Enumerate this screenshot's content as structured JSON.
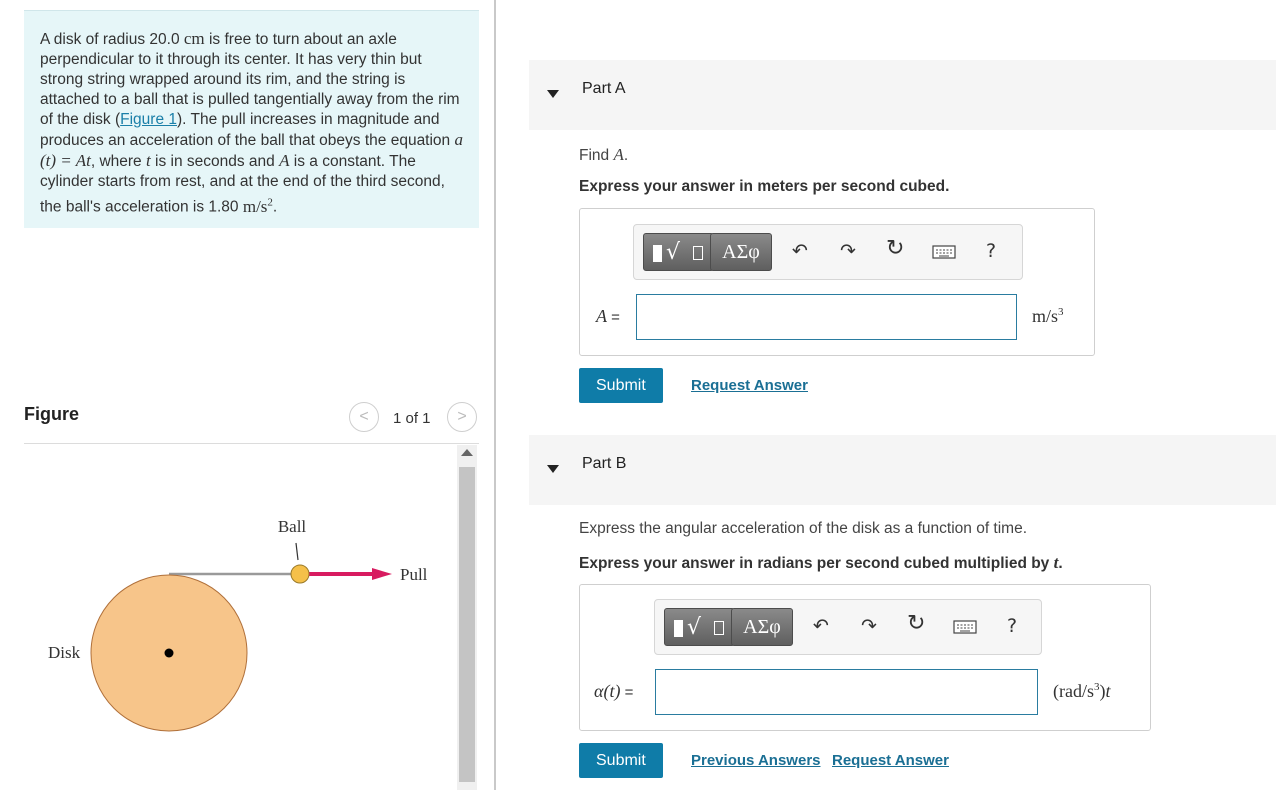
{
  "problem": {
    "s1": "A disk of radius 20.0 ",
    "u_cm": "cm",
    "s2": " is free to turn about an axle perpendicular to it through its center. It has very thin but strong string wrapped around its rim, and the string is attached to a ball that is pulled tangentially away from the rim of the disk (",
    "figure_link": "Figure 1",
    "s3": "). The pull increases in magnitude and produces an acceleration of the ball that obeys the equation ",
    "eq1": "a (t) = At",
    "s4": ", where ",
    "var_t": "t",
    "s5": " is in seconds and ",
    "var_A": "A",
    "s6": " is a constant. The cylinder starts from rest, and at the end of the third second, the ball's acceleration is 1.80 ",
    "u_accel_base": "m/s",
    "u_accel_exp": "2",
    "s7": "."
  },
  "figure": {
    "title": "Figure",
    "prev_icon": "chevron-left-icon",
    "next_icon": "chevron-right-icon",
    "counter": "1 of 1",
    "labels": {
      "ball": "Ball",
      "pull": "Pull",
      "disk": "Disk"
    },
    "colors": {
      "disk": "#f7c58a",
      "ball": "#f5c04a",
      "arrow": "#d81b60",
      "string": "#9a9a9a"
    }
  },
  "partA": {
    "title": "Part A",
    "question_prefix": "Find ",
    "question_var": "A",
    "question_suffix": ".",
    "instruction": "Express your answer in meters per second cubed.",
    "toolbar": {
      "greek": "ΑΣφ",
      "icons": [
        "templates-icon",
        "greek-icon",
        "undo-icon",
        "redo-icon",
        "reset-icon",
        "keyboard-icon",
        "help-icon"
      ]
    },
    "label_var": "A",
    "label_eq": " =",
    "unit_base": "m/s",
    "unit_exp": "3",
    "input_value": "",
    "submit": "Submit",
    "request_answer": "Request Answer"
  },
  "partB": {
    "title": "Part B",
    "question": "Express the angular acceleration of the disk as a function of time.",
    "instruction_prefix": "Express your answer in radians per second cubed multiplied by ",
    "instruction_var": "t",
    "instruction_suffix": ".",
    "label_var": "α(t)",
    "label_eq": " =",
    "unit_open": "(rad/s",
    "unit_exp": "3",
    "unit_close": ")",
    "unit_var": "t",
    "input_value": "",
    "submit": "Submit",
    "previous_answers": "Previous Answers",
    "request_answer": "Request Answer"
  },
  "toolbar_help": "?",
  "accent_color": "#0f7ca8"
}
